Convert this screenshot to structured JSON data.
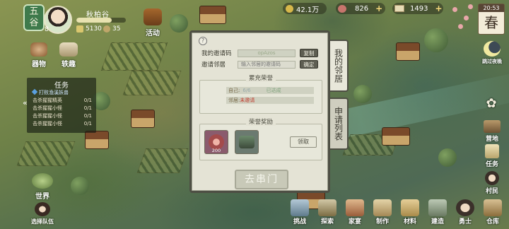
{
  "player": {
    "realm": "五谷",
    "level": "8",
    "name": "秋柏谷",
    "exp_fraction": 0.72,
    "coins": "5130",
    "people": "35"
  },
  "top_left_buttons": {
    "activity": "活动",
    "wares": "器物",
    "events": "轶趣"
  },
  "tasks": {
    "title": "任务",
    "collapse_icon": "«",
    "items": [
      {
        "text": "打败渔溪妖兽",
        "count": ""
      },
      {
        "text": "击杀猩猩精英",
        "count": "0/1"
      },
      {
        "text": "击杀猩猩小怪",
        "count": "0/1"
      },
      {
        "text": "击杀猩猩小怪",
        "count": "0/1"
      },
      {
        "text": "击杀猩猩小怪",
        "count": "0/1"
      }
    ]
  },
  "left_bottom": {
    "world": "世界",
    "select_team": "选择队伍"
  },
  "currency": {
    "coin": "42.1万",
    "meat": "826",
    "scroll": "1493",
    "plus": "+"
  },
  "clock": {
    "time": "20:53",
    "season": "春"
  },
  "right_side": {
    "skip_night": "跳过夜晚",
    "camp": "营地",
    "tasks": "任务",
    "villagers": "村民"
  },
  "dialog": {
    "help": "?",
    "my_code_label": "我的邀请码",
    "my_code_value": "opAzos",
    "copy_button": "复制",
    "invite_label": "邀请邻居",
    "invite_placeholder": "输入邻居的邀请码",
    "confirm_button": "确定",
    "honor_title": "累充荣誉",
    "self_label": "自己:",
    "self_value": "6/6",
    "self_status": "已达成",
    "neighbor_label": "邻居:",
    "neighbor_status": "未邀请",
    "reward_title": "荣誉奖励",
    "reward_count": "200",
    "claim_button": "领取",
    "main_button": "去串门"
  },
  "tabs": {
    "my_neighbors": "我的邻居",
    "apply_list": "申请列表"
  },
  "bottom_nav": [
    "挑战",
    "探索",
    "家宴",
    "制作",
    "材料",
    "建造",
    "勇士",
    "仓库"
  ],
  "colors": {
    "dialog_bg": "#e4e3d5",
    "dialog_border": "#4e4f44",
    "neighbor_warn": "#c0392b",
    "realm_badge": "#3f7a4c"
  }
}
